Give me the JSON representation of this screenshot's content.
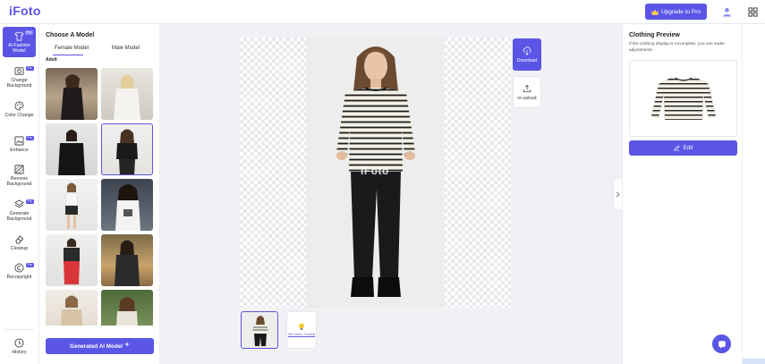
{
  "app": {
    "logo": "iFoto"
  },
  "header": {
    "upgrade_label": "Upgrade to Pro"
  },
  "tools": [
    {
      "label": "AI Fashion Model",
      "icon": "tshirt-icon",
      "pro": "Pro",
      "active": true
    },
    {
      "label": "Change Background",
      "icon": "image-swap-icon",
      "pro": "Pro"
    },
    {
      "label": "Color Change",
      "icon": "palette-icon"
    },
    {
      "label": "Enhance",
      "icon": "enhance-icon",
      "pro": "Pro"
    },
    {
      "label": "Remove Background",
      "icon": "eraser-icon"
    },
    {
      "label": "Generate Background",
      "icon": "layers-icon",
      "pro": "Pro"
    },
    {
      "label": "Cleanup",
      "icon": "cleanup-icon"
    },
    {
      "label": "Recopyright",
      "icon": "copyright-icon",
      "pro": "Pro"
    },
    {
      "label": "History",
      "icon": "history-icon"
    }
  ],
  "model_panel": {
    "title": "Choose A Model",
    "tabs": [
      {
        "label": "Female Model",
        "active": true
      },
      {
        "label": "Male Model"
      }
    ],
    "section_label": "Adult",
    "generate_label": "Generated AI Model"
  },
  "canvas": {
    "watermark": "iFoto",
    "download_label": "Download",
    "reupload_label": "re-upload",
    "video_tutorial_label": "30s Video Tutorial"
  },
  "clothing_preview": {
    "title": "Clothing Preview",
    "description": "If the clothing display is incomplete, you can make adjustments.",
    "edit_label": "Edit"
  },
  "colors": {
    "accent": "#5b55e6"
  }
}
